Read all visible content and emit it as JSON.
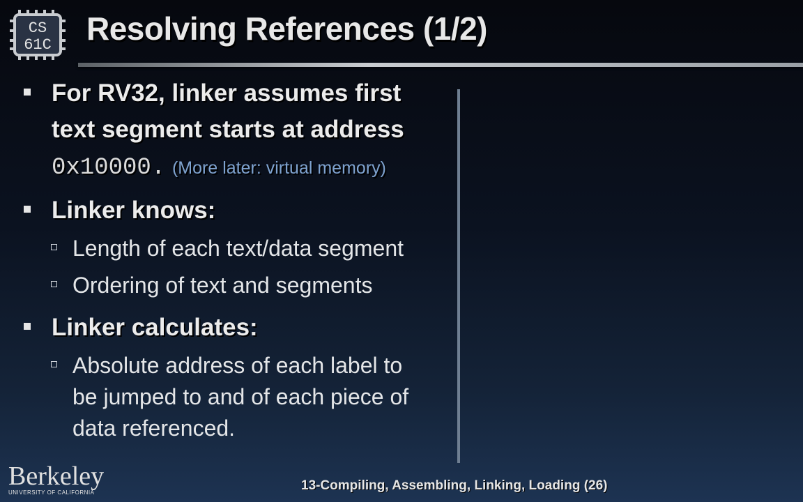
{
  "logo": {
    "line1": "CS",
    "line2": "61C"
  },
  "title": "Resolving References (1/2)",
  "bullets": {
    "first": {
      "line1": "For RV32, linker assumes first",
      "line2": "text segment starts at address",
      "code": "0x10000.",
      "note": "(More later: virtual memory)"
    },
    "knows": {
      "label": "Linker knows:",
      "items": [
        "Length of each text/data segment",
        "Ordering of text and segments"
      ]
    },
    "calculates": {
      "label": "Linker calculates:",
      "item_lines": [
        "Absolute address of each label to",
        "be jumped to and of each piece of",
        "data referenced."
      ]
    }
  },
  "footer": {
    "institution": "Berkeley",
    "institution_sub": "UNIVERSITY OF CALIFORNIA",
    "lecture": "13-Compiling, Assembling, Linking, Loading (26)"
  },
  "colors": {
    "note": "#7fa3d0",
    "divider": "#6f7f92"
  }
}
